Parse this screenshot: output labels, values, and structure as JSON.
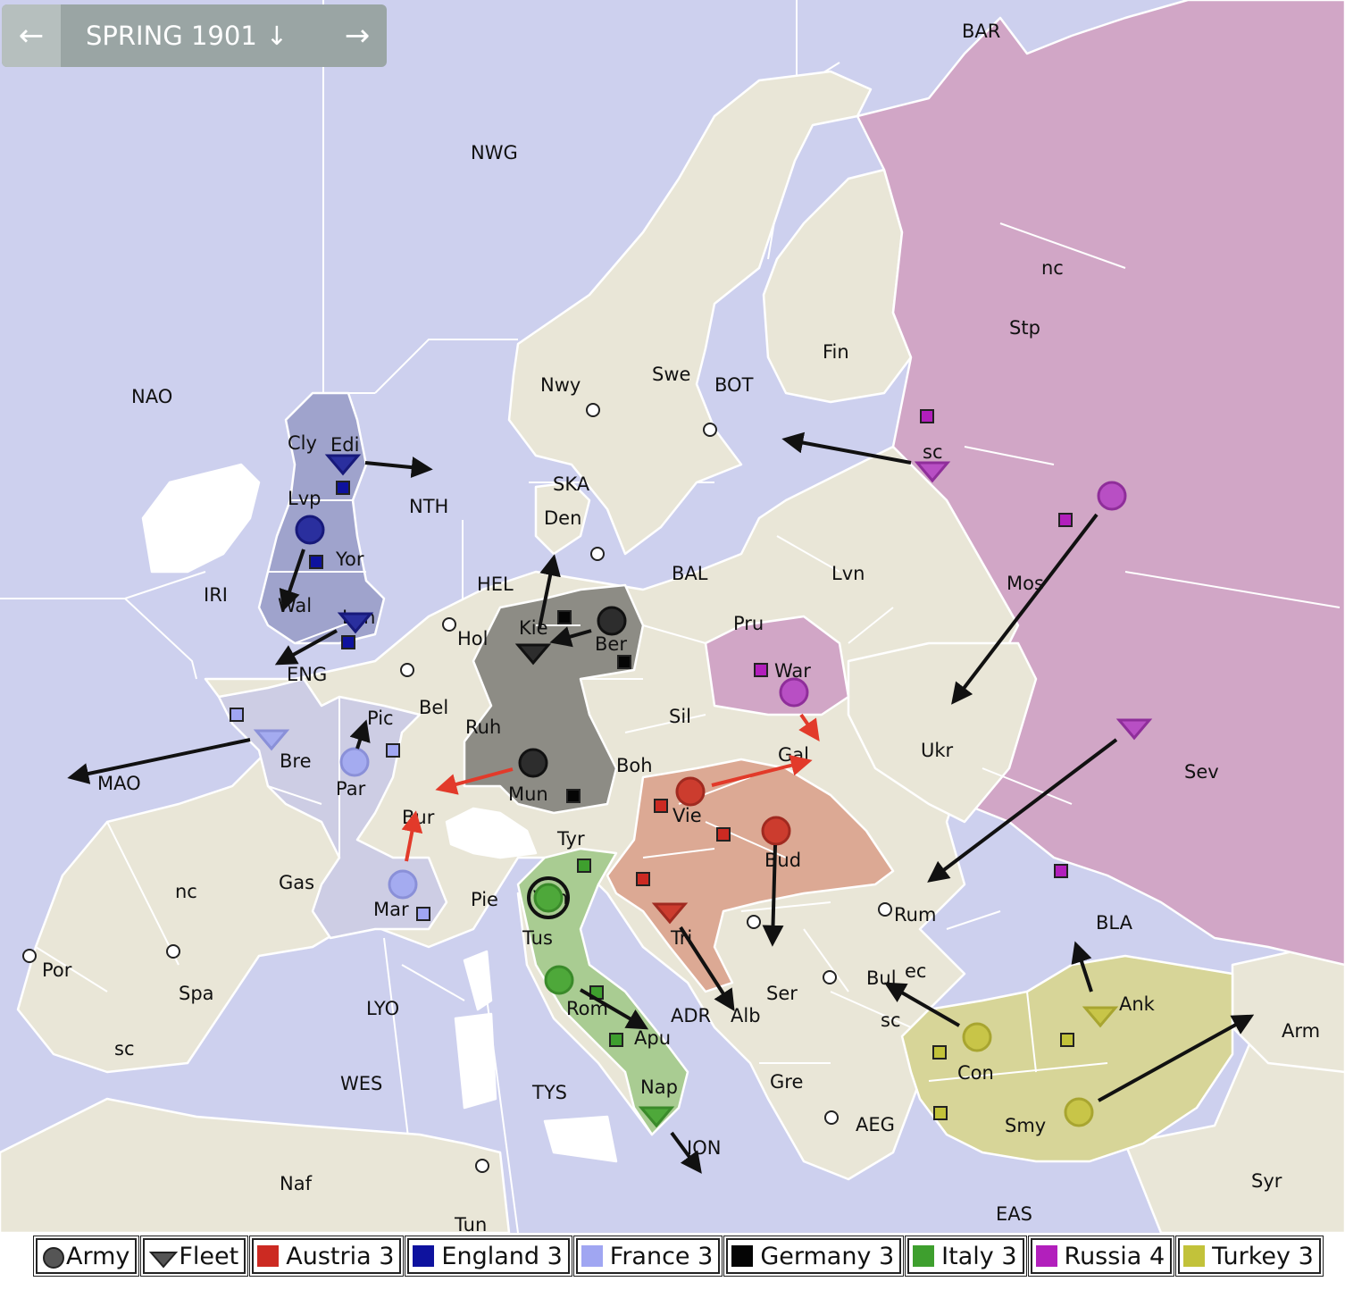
{
  "phase": {
    "label": "SPRING 1901",
    "prev_icon": "arrow-left-icon",
    "menu_icon": "arrow-down-icon",
    "next_icon": "arrow-right-icon"
  },
  "colors": {
    "sea": "#cdd0ee",
    "land": "#e9e6d7",
    "russia": "#d1a6c6",
    "austria": "#dca994",
    "germany": "#8d8c85",
    "england": "#9fa3cc",
    "france": "#cdcde4",
    "italy": "#a9cc92",
    "turkey": "#d7d598",
    "austria_unit": "#cc3c2e",
    "england_unit": "#2a2f9e",
    "france_unit": "#a4abf0",
    "germany_unit": "#2d2d2d",
    "italy_unit": "#4ea83a",
    "russia_unit": "#b84fc4",
    "turkey_unit": "#c8c548"
  },
  "labels": {
    "BAR": "BAR",
    "NWG": "NWG",
    "NAO": "NAO",
    "nc_stp": "nc",
    "Stp": "Stp",
    "Fin": "Fin",
    "Nwy": "Nwy",
    "Swe": "Swe",
    "BOT": "BOT",
    "sc_stp": "sc",
    "Cly": "Cly",
    "Edi": "Edi",
    "NTH": "NTH",
    "SKA": "SKA",
    "Lvp": "Lvp",
    "Den": "Den",
    "Yor": "Yor",
    "BAL": "BAL",
    "Lvn": "Lvn",
    "Mos": "Mos",
    "IRI": "IRI",
    "HEL": "HEL",
    "Wal": "Wal",
    "Lon": "Lon",
    "Kie": "Kie",
    "Pru": "Pru",
    "Hol": "Hol",
    "Ber": "Ber",
    "ENG": "ENG",
    "War": "War",
    "Bel": "Bel",
    "Pic": "Pic",
    "Ruh": "Ruh",
    "Sil": "Sil",
    "Ukr": "Ukr",
    "Bre": "Bre",
    "MAO": "MAO",
    "Gal": "Gal",
    "Sev": "Sev",
    "Par": "Par",
    "Boh": "Boh",
    "Mun": "Mun",
    "Vie": "Vie",
    "Bur": "Bur",
    "Tyr": "Tyr",
    "Bud": "Bud",
    "Gas": "Gas",
    "nc_spa": "nc",
    "Pie": "Pie",
    "Ven": "Ven",
    "Mar": "Mar",
    "Rum": "Rum",
    "BLA": "BLA",
    "Tus": "Tus",
    "Tri": "Tri",
    "Por": "Por",
    "ec_bul": "ec",
    "Bul": "Bul",
    "Spa": "Spa",
    "Ser": "Ser",
    "Rom": "Rom",
    "LYO": "LYO",
    "Ank": "Ank",
    "ADR": "ADR",
    "Alb": "Alb",
    "sc_bul": "sc",
    "Apu": "Apu",
    "Arm": "Arm",
    "sc_spa": "sc",
    "Con": "Con",
    "Nap": "Nap",
    "WES": "WES",
    "TYS": "TYS",
    "Gre": "Gre",
    "AEG": "AEG",
    "Smy": "Smy",
    "ION": "ION",
    "Naf": "Naf",
    "Syr": "Syr",
    "EAS": "EAS",
    "Tun": "Tun"
  },
  "legend": {
    "army": "Army",
    "fleet": "Fleet",
    "powers": [
      {
        "label": "Austria 3",
        "color": "#cc2a22"
      },
      {
        "label": "England 3",
        "color": "#0e129e"
      },
      {
        "label": "France 3",
        "color": "#a0a6f2"
      },
      {
        "label": "Germany 3",
        "color": "#050505"
      },
      {
        "label": "Italy 3",
        "color": "#3e9f2e"
      },
      {
        "label": "Russia 4",
        "color": "#b21fbc"
      },
      {
        "label": "Turkey 3",
        "color": "#c2c23a"
      }
    ]
  }
}
